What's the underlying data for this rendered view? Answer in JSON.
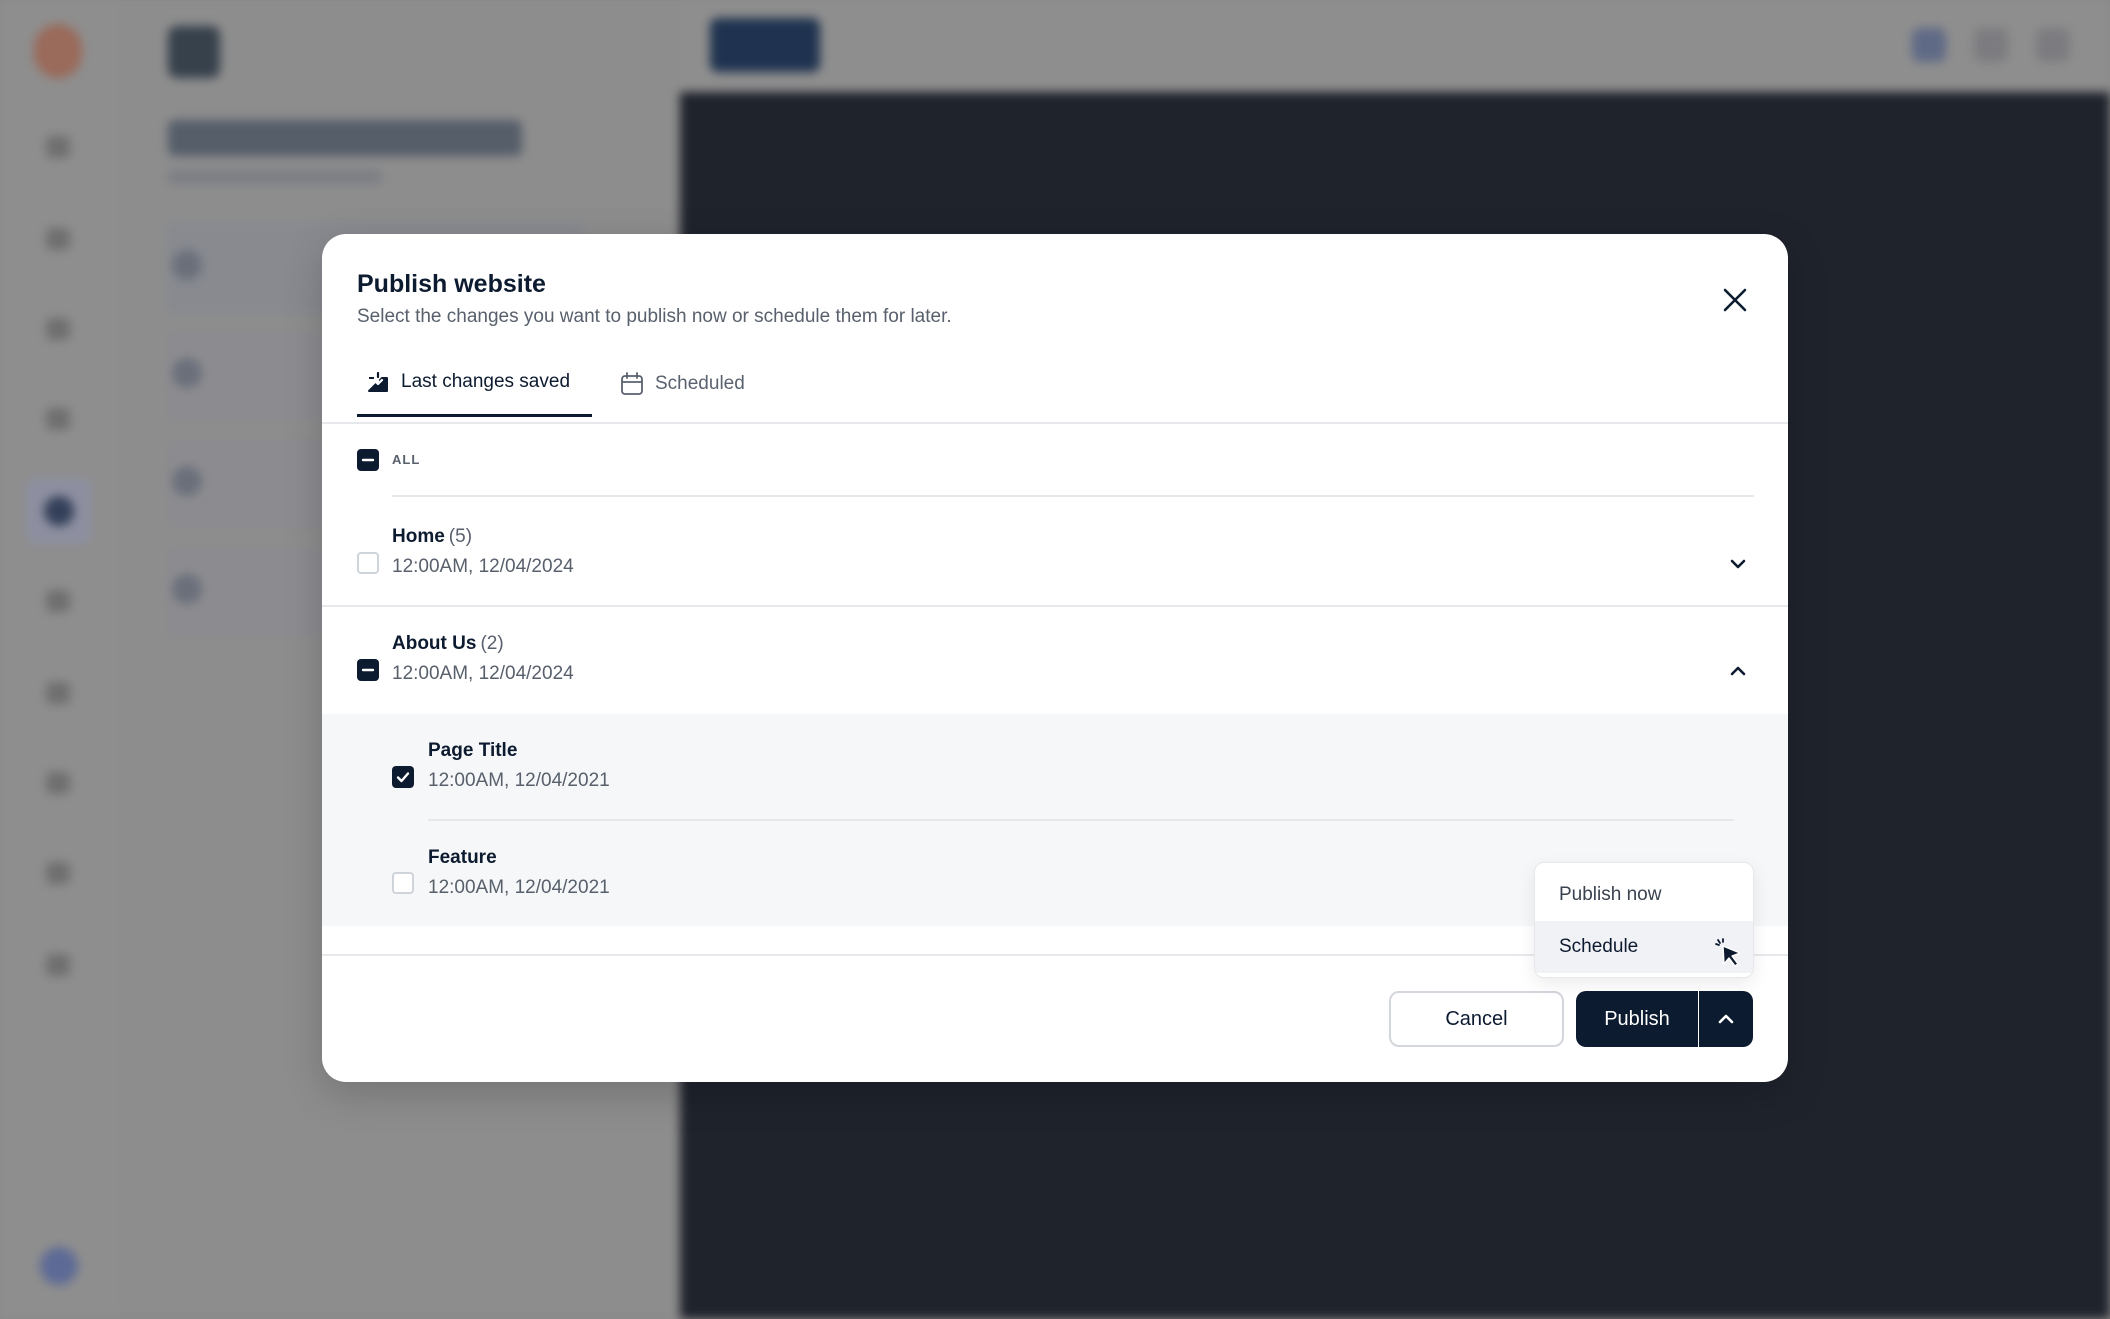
{
  "modal": {
    "title": "Publish website",
    "subtitle": "Select the changes you want to publish now or schedule them for later.",
    "tabs": [
      {
        "label": "Last changes saved",
        "icon": "download-box-icon",
        "active": true
      },
      {
        "label": "Scheduled",
        "icon": "calendar-icon",
        "active": false
      }
    ],
    "all_label": "ALL",
    "groups": [
      {
        "title": "Home",
        "count": "(5)",
        "date": "12:00AM, 12/04/2024",
        "checked": "none",
        "expanded": false
      },
      {
        "title": "About Us",
        "count": "(2)",
        "date": "12:00AM, 12/04/2024",
        "checked": "partial",
        "expanded": true,
        "children": [
          {
            "title": "Page Title",
            "date": "12:00AM, 12/04/2021",
            "checked": true
          },
          {
            "title": "Feature",
            "date": "12:00AM, 12/04/2021",
            "checked": false
          }
        ]
      }
    ],
    "footer": {
      "cancel_label": "Cancel",
      "publish_label": "Publish"
    },
    "publish_menu": {
      "items": [
        "Publish now",
        "Schedule"
      ],
      "highlighted": "Schedule"
    }
  },
  "colors": {
    "primary": "#0d1b30",
    "overlay": "#8a8a8a",
    "muted_text": "#58606c",
    "divider": "#e6e8ec"
  }
}
